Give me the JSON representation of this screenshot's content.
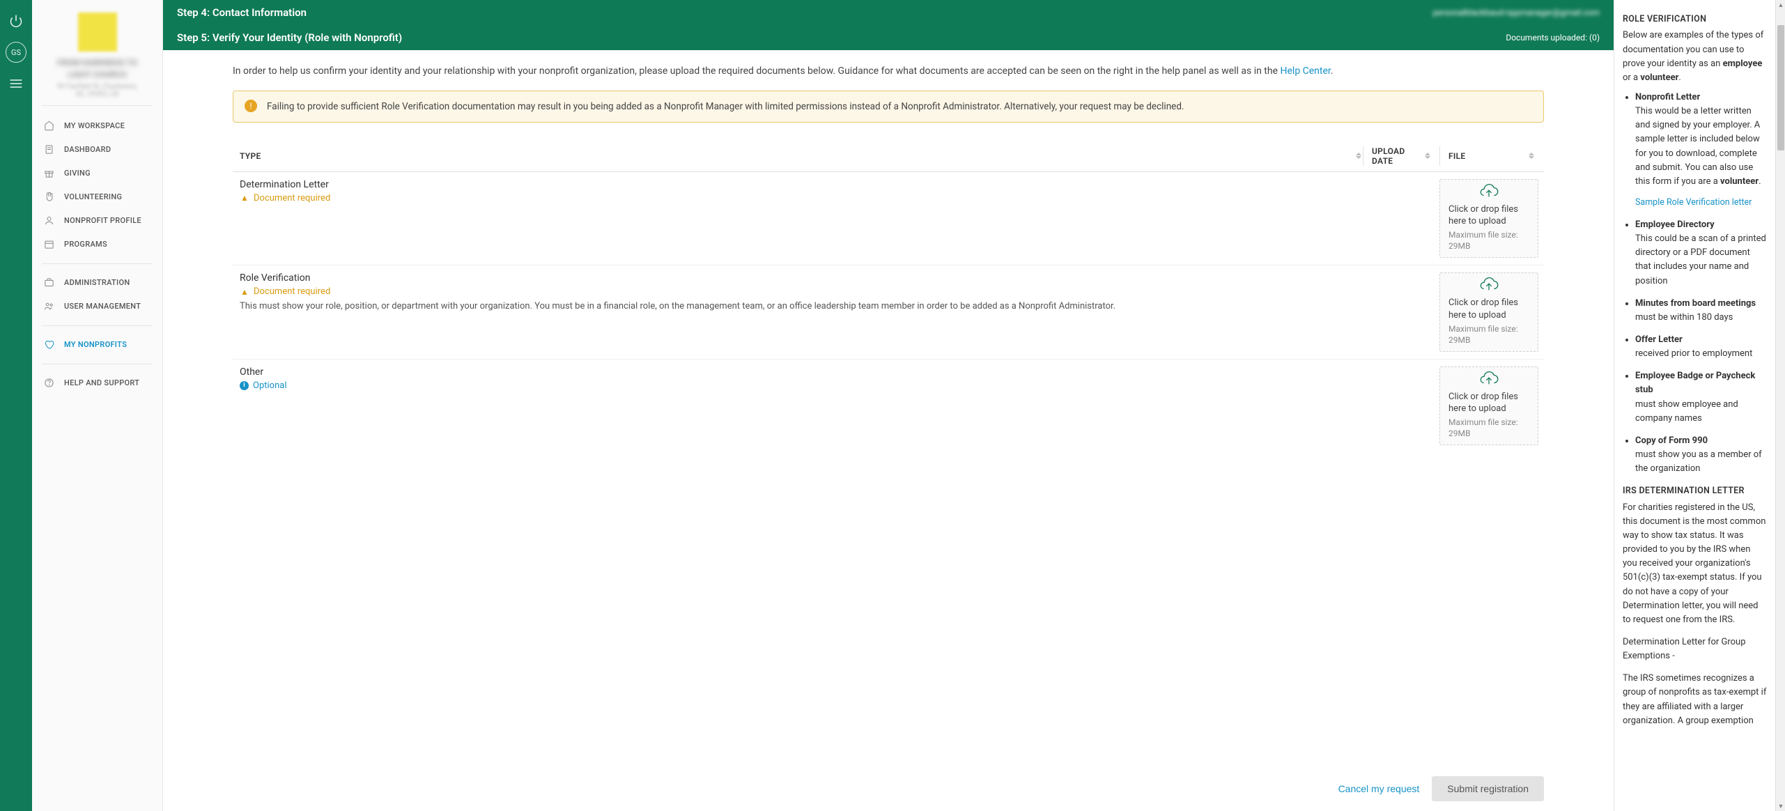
{
  "rail": {
    "avatar_initials": "GS"
  },
  "org": {
    "name": "FROM DARKNESS TO LIGHT CHURCH",
    "address": "99 Fairfield St, Charleston, SC, 29492, US"
  },
  "nav": {
    "my_workspace": "MY WORKSPACE",
    "dashboard": "DASHBOARD",
    "giving": "GIVING",
    "volunteering": "VOLUNTEERING",
    "nonprofit_profile": "NONPROFIT PROFILE",
    "programs": "PROGRAMS",
    "administration": "ADMINISTRATION",
    "user_management": "USER MANAGEMENT",
    "my_nonprofits": "MY NONPROFITS",
    "help_support": "HELP AND SUPPORT"
  },
  "steps": {
    "step4_title": "Step 4: Contact Information",
    "step4_meta": "personalblackbaud-nppmanager@gmail.com",
    "step5_title": "Step 5: Verify Your Identity (Role with Nonprofit)",
    "step5_meta": "Documents uploaded: (0)"
  },
  "intro": {
    "text_a": "In order to help us confirm your identity and your relationship with your nonprofit organization, please upload the required documents below. Guidance for what documents are accepted can be seen on the right in the help panel as well as in the ",
    "link": "Help Center",
    "text_b": "."
  },
  "warning": "Failing to provide sufficient Role Verification documentation may result in you being added as a Nonprofit Manager with limited permissions instead of a Nonprofit Administrator. Alternatively, your request may be declined.",
  "table": {
    "col_type": "TYPE",
    "col_date": "UPLOAD DATE",
    "col_file": "FILE",
    "status_required": "Document required",
    "status_optional": "Optional",
    "dz_text": "Click or drop files here to upload",
    "dz_sub": "Maximum file size: 29MB",
    "rows": [
      {
        "title": "Determination Letter",
        "status": "required",
        "desc": ""
      },
      {
        "title": "Role Verification",
        "status": "required",
        "desc": "This must show your role, position, or department with your organization. You must be in a financial role, on the management team, or an office leadership team member in order to be added as a Nonprofit Administrator."
      },
      {
        "title": "Other",
        "status": "optional",
        "desc": ""
      }
    ]
  },
  "actions": {
    "cancel": "Cancel my request",
    "submit": "Submit registration"
  },
  "help": {
    "h1": "ROLE VERIFICATION",
    "p1a": "Below are examples of the types of documentation you can use to prove your identity as an ",
    "p1b_strong": "employee",
    "p1c": " or a ",
    "p1d_strong": "volunteer",
    "p1e": ".",
    "li1_t": "Nonprofit Letter",
    "li1_b": "This would be a letter written and signed by your employer. A sample letter is included below for you to download, complete and submit. You can also use this form if you are a ",
    "li1_strong": "volunteer",
    "li1_end": ".",
    "sample_link": "Sample Role Verification letter",
    "li2_t": "Employee Directory",
    "li2_b": "This could be a scan of a printed directory or a PDF document that includes your name and position",
    "li3_t": "Minutes from board meetings",
    "li3_b": "must be within 180 days",
    "li4_t": "Offer Letter",
    "li4_b": "received prior to employment",
    "li5_t": "Employee Badge or Paycheck stub",
    "li5_b": "must show employee and company names",
    "li6_t": "Copy of Form 990",
    "li6_b": "must show you as a member of the organization",
    "h2": "IRS DETERMINATION LETTER",
    "p2": "For charities registered in the US, this document is the most common way to show tax status. It was provided to you by the IRS when you received your organization's 501(c)(3) tax-exempt status. If you do not have a copy of your Determination letter, you will need to request one from the IRS.",
    "p3": "Determination Letter for Group Exemptions -",
    "p4": "The IRS sometimes recognizes a group of nonprofits as tax-exempt if they are affiliated with a larger organization. A group exemption"
  }
}
